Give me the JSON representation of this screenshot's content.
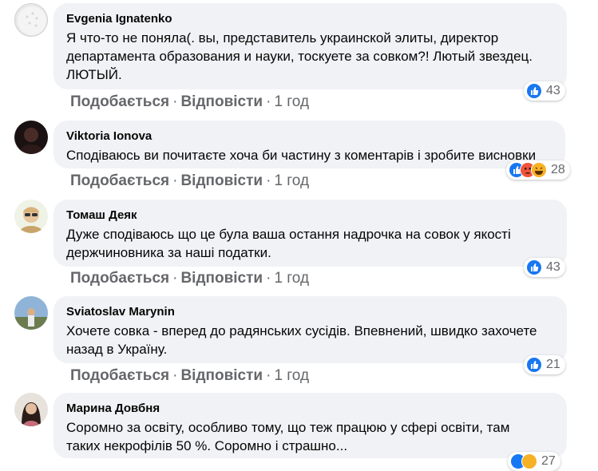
{
  "comments": [
    {
      "author": "Evgenia Ignatenko",
      "text_lines": [
        "Я что-то не поняла(. вы, представитель украинской элиты, директор",
        "департамента образования и науки, тоскуете за совком?! Лютый звездец.",
        "ЛЮТЫЙ."
      ],
      "reactions": "43",
      "actions": {
        "like": "Подобається",
        "reply": "Відповісти",
        "sep": "·",
        "time": "1 год"
      }
    },
    {
      "author": "Viktoria Ionova",
      "text_lines": [
        "Сподіваюсь ви почитаєте хоча би частину з коментарів і зробите висновки"
      ],
      "reactions": "28",
      "actions": {
        "like": "Подобається",
        "reply": "Відповісти",
        "sep": "·",
        "time": "1 год"
      }
    },
    {
      "author": "Томаш Деяк",
      "text_lines": [
        "Дуже сподіваюсь що це була ваша остання надрочка на совок у якості",
        "держчиновника за наші податки."
      ],
      "reactions": "43",
      "actions": {
        "like": "Подобається",
        "reply": "Відповісти",
        "sep": "·",
        "time": "1 год"
      }
    },
    {
      "author": "Sviatoslav Marynin",
      "text_lines": [
        "Хочете совка - вперед до радянських сусідів. Впевнений, швидко захочете",
        "назад в Україну."
      ],
      "reactions": "21",
      "actions": {
        "like": "Подобається",
        "reply": "Відповісти",
        "sep": "·",
        "time": "1 год"
      }
    },
    {
      "author": "Марина Довбня",
      "text_lines": [
        "Соромно за освіту, особливо тому, що теж працюю у сфері освіти, там",
        "таких некрофілів 50 %. Соромно і страшно..."
      ],
      "reactions": "27",
      "actions": {
        "like": "",
        "reply": "",
        "sep": "",
        "time": ""
      }
    }
  ],
  "colors": {
    "bubble": "#f0f2f5",
    "like": "#1877f2",
    "angry": "#f0533a",
    "laugh": "#f7b125",
    "meta": "#65676b"
  },
  "icons": [
    "like-icon",
    "angry-icon",
    "laugh-icon"
  ]
}
